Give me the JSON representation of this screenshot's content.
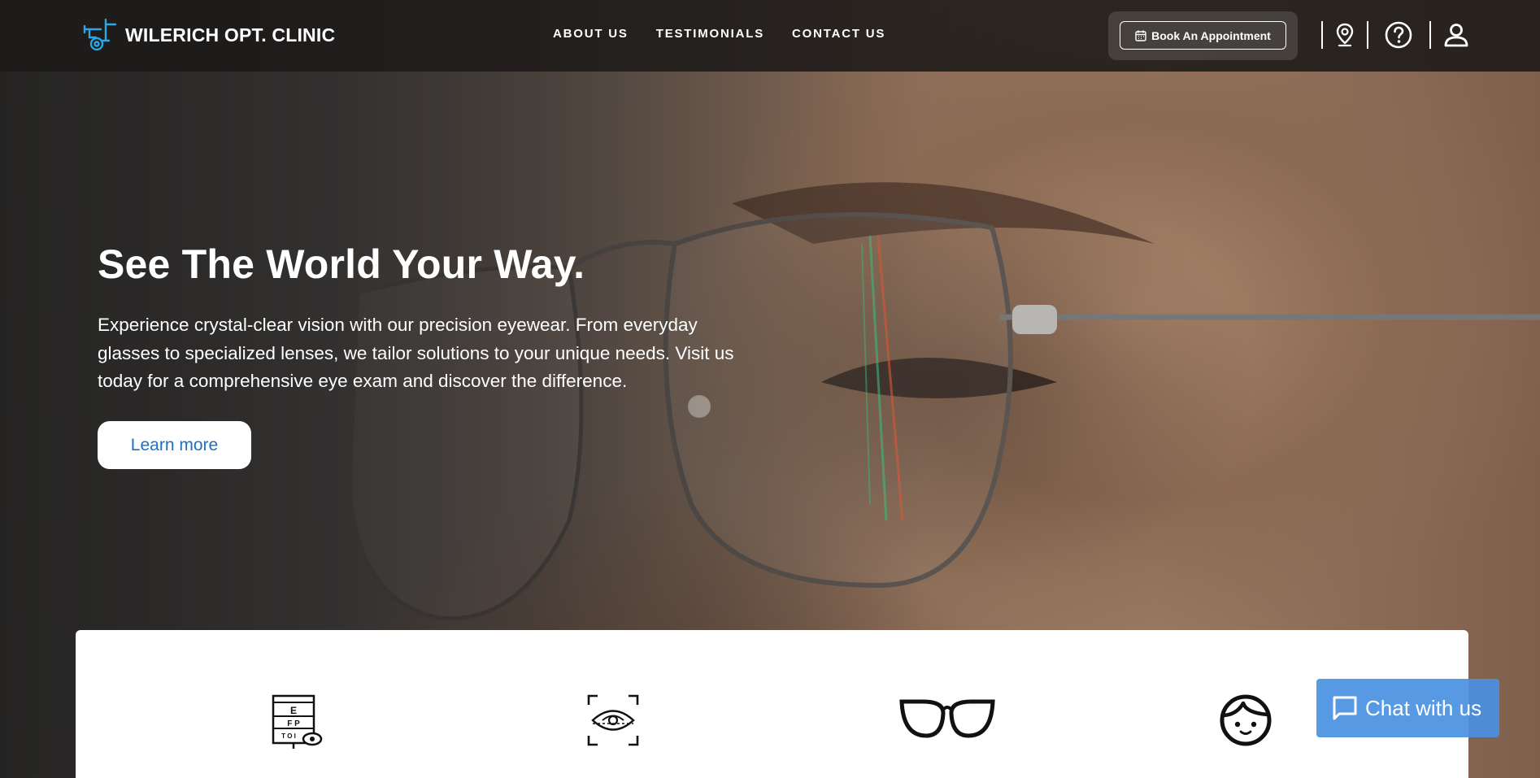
{
  "brand": {
    "name": "WILERICH OPT. CLINIC",
    "accent": "#2aa7e6"
  },
  "nav": {
    "items": [
      "ABOUT US",
      "TESTIMONIALS",
      "CONTACT US"
    ]
  },
  "header": {
    "book_label": "Book An Appointment",
    "icons": [
      "location-icon",
      "help-icon",
      "user-icon"
    ]
  },
  "hero": {
    "title": "See The World Your Way.",
    "description": "Experience crystal-clear vision with our precision eyewear. From everyday glasses to specialized lenses, we tailor solutions to your unique needs. Visit us today for a comprehensive eye exam and discover the difference.",
    "cta_label": "Learn more"
  },
  "services": {
    "icons": [
      "eye-chart-icon",
      "eye-scan-icon",
      "eyeglasses-icon",
      "child-face-icon"
    ]
  },
  "chat": {
    "label": "Chat with us",
    "color": "#4a90e2"
  }
}
